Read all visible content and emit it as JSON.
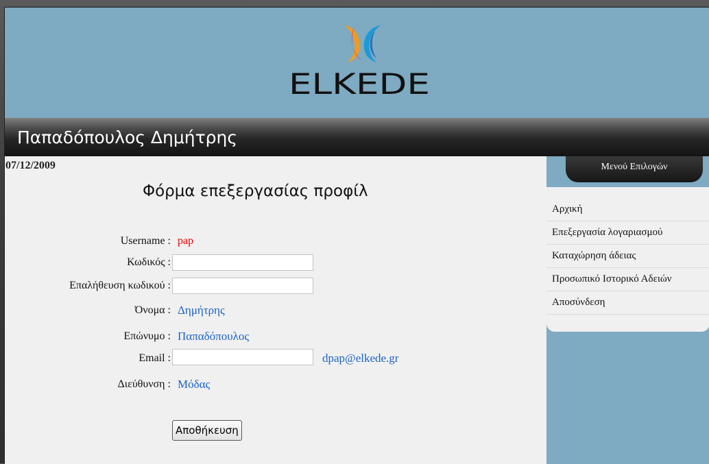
{
  "logo": {
    "text": "ELKEDE"
  },
  "user": {
    "display_name": "Παπαδόπουλος Δημήτρης"
  },
  "date": "07/12/2009",
  "form": {
    "title": "Φόρμα επεξεργασίας προφίλ",
    "username_label": "Username :",
    "username_value": "pap",
    "password_label": "Κωδικός :",
    "password_value": "",
    "confirm_label": "Επαλήθευση κωδικού :",
    "confirm_value": "",
    "first_name_label": "Όνομα :",
    "first_name_value": "Δημήτρης",
    "last_name_label": "Επώνυμο :",
    "last_name_value": "Παπαδόπουλος",
    "email_label": "Email :",
    "email_input_value": "",
    "email_current": "dpap@elkede.gr",
    "address_label": "Διεύθυνση :",
    "address_value": "Μόδας",
    "save_label": "Αποθήκευση"
  },
  "menu": {
    "title": "Μενού Επιλογών",
    "items": [
      {
        "label": "Αρχική"
      },
      {
        "label": "Επεξεργασία λογαριασμού"
      },
      {
        "label": "Καταχώρηση άδειας"
      },
      {
        "label": "Προσωπικό Ιστορικό Αδειών"
      },
      {
        "label": "Αποσύνδεση"
      }
    ]
  },
  "colors": {
    "header_bg": "#7eaac2",
    "value_red": "#e80000",
    "value_blue": "#1a63c8",
    "logo_orange": "#f39a1e",
    "logo_blue": "#1b9ad6",
    "logo_magenta": "#c8206a"
  }
}
